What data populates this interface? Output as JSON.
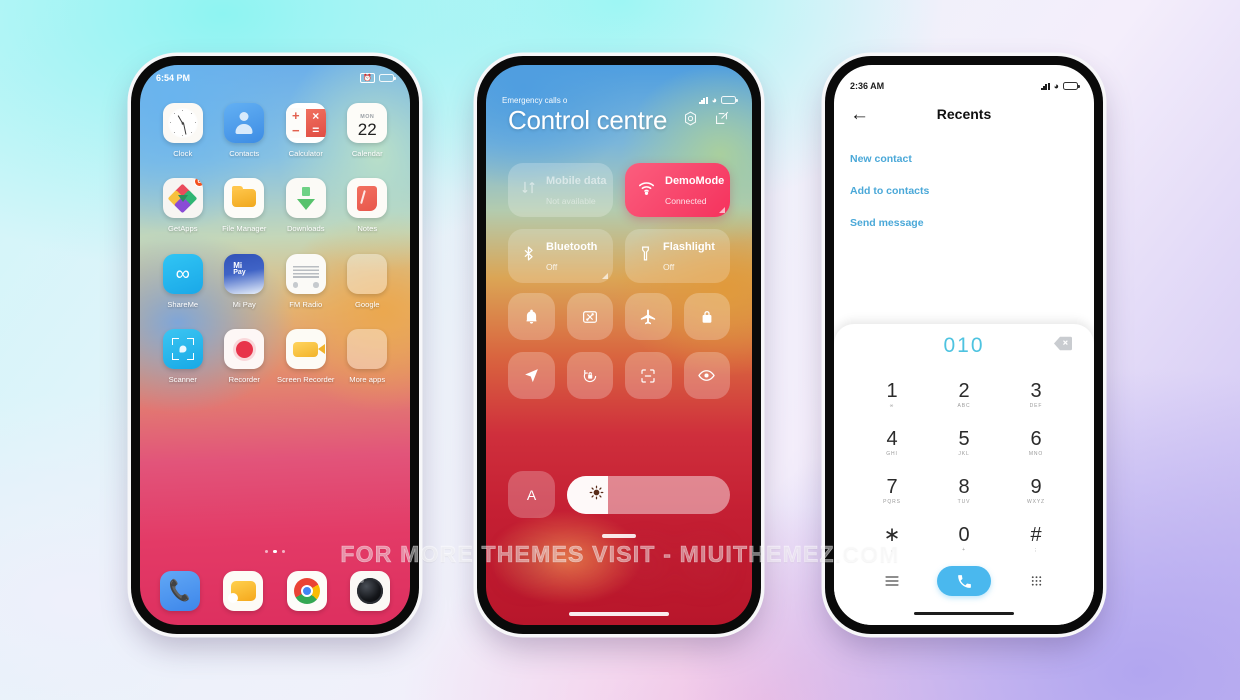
{
  "watermark": "FOR MORE THEMES VISIT - MIUITHEMEZ.COM",
  "phone1": {
    "status": {
      "time": "6:54 PM",
      "icons": [
        "alarm-icon",
        "battery-icon"
      ]
    },
    "apps": [
      {
        "label": "Clock",
        "icon": "clock-icon"
      },
      {
        "label": "Contacts",
        "icon": "contacts-icon"
      },
      {
        "label": "Calculator",
        "icon": "calculator-icon"
      },
      {
        "label": "Calendar",
        "icon": "calendar-icon",
        "month": "MON",
        "day": "22"
      },
      {
        "label": "GetApps",
        "icon": "getapps-icon",
        "badge": "6"
      },
      {
        "label": "File Manager",
        "icon": "file-manager-icon"
      },
      {
        "label": "Downloads",
        "icon": "downloads-icon"
      },
      {
        "label": "Notes",
        "icon": "notes-icon"
      },
      {
        "label": "ShareMe",
        "icon": "shareme-icon"
      },
      {
        "label": "Mi Pay",
        "icon": "mi-pay-icon",
        "t1": "Mi",
        "t2": "Pay"
      },
      {
        "label": "FM Radio",
        "icon": "fm-radio-icon"
      },
      {
        "label": "Google",
        "icon": "google-folder-icon"
      },
      {
        "label": "Scanner",
        "icon": "scanner-icon"
      },
      {
        "label": "Recorder",
        "icon": "recorder-icon"
      },
      {
        "label": "Screen Recorder",
        "icon": "screen-recorder-icon"
      },
      {
        "label": "More apps",
        "icon": "more-apps-folder-icon"
      }
    ],
    "page_dots": 3,
    "active_dot": 2,
    "dock": [
      {
        "label": "Phone",
        "icon": "phone-icon"
      },
      {
        "label": "Messages",
        "icon": "messages-icon"
      },
      {
        "label": "Chrome",
        "icon": "chrome-icon"
      },
      {
        "label": "Camera",
        "icon": "camera-icon"
      }
    ]
  },
  "phone2": {
    "status": {
      "carrier": "Emergency calls o"
    },
    "title": "Control centre",
    "header_icons": [
      "settings-icon",
      "edit-icon"
    ],
    "big_tiles": [
      {
        "title": "Mobile data",
        "sub": "Not available",
        "state": "off",
        "icon": "mobile-data-icon"
      },
      {
        "title": "DemoMode",
        "sub": "Connected",
        "state": "on",
        "icon": "wifi-icon"
      },
      {
        "title": "Bluetooth",
        "sub": "Off",
        "state": "dim",
        "icon": "bluetooth-icon"
      },
      {
        "title": "Flashlight",
        "sub": "Off",
        "state": "dim",
        "icon": "flashlight-icon"
      }
    ],
    "mini_tiles": [
      "silent-icon",
      "cast-icon",
      "airplane-icon",
      "lock-icon",
      "location-icon",
      "rotation-lock-icon",
      "scan-icon",
      "reading-mode-icon"
    ],
    "auto_brightness_label": "A",
    "brightness_percent": 25
  },
  "phone3": {
    "status": {
      "time": "2:36 AM"
    },
    "title": "Recents",
    "back_icon": "back-arrow-icon",
    "links": [
      "New contact",
      "Add to contacts",
      "Send message"
    ],
    "dialed_number": "010",
    "backspace_icon": "backspace-icon",
    "keys": [
      {
        "n": "1",
        "s": "∞"
      },
      {
        "n": "2",
        "s": "ABC"
      },
      {
        "n": "3",
        "s": "DEF"
      },
      {
        "n": "4",
        "s": "GHI"
      },
      {
        "n": "5",
        "s": "JKL"
      },
      {
        "n": "6",
        "s": "MNO"
      },
      {
        "n": "7",
        "s": "PQRS"
      },
      {
        "n": "8",
        "s": "TUV"
      },
      {
        "n": "9",
        "s": "WXYZ"
      },
      {
        "n": "∗",
        "s": ","
      },
      {
        "n": "0",
        "s": "+"
      },
      {
        "n": "#",
        "s": ";"
      }
    ],
    "actions": {
      "left": "menu-icon",
      "call": "call-icon",
      "right": "keypad-icon"
    },
    "accent_color": "#4ab8ee",
    "link_color": "#4aa8d8",
    "number_color": "#4ec3e0"
  }
}
